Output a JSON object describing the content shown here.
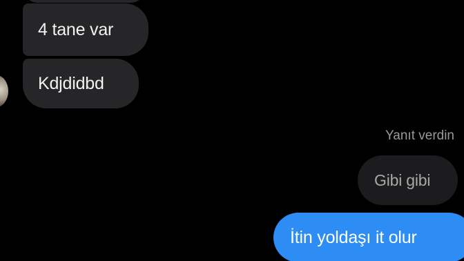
{
  "conversation": {
    "messages_in": [
      {
        "text": "4 tane var"
      },
      {
        "text": "Kdjdidbd"
      }
    ],
    "reply_indicator": "Yanıt verdin",
    "quoted_message": "Gibi gibi",
    "message_out": "İtin yoldaşı it olur"
  },
  "colors": {
    "background": "#000000",
    "incoming_bubble": "#262628",
    "quoted_bubble": "#1c1c1e",
    "outgoing_bubble": "#2e8cf5"
  }
}
